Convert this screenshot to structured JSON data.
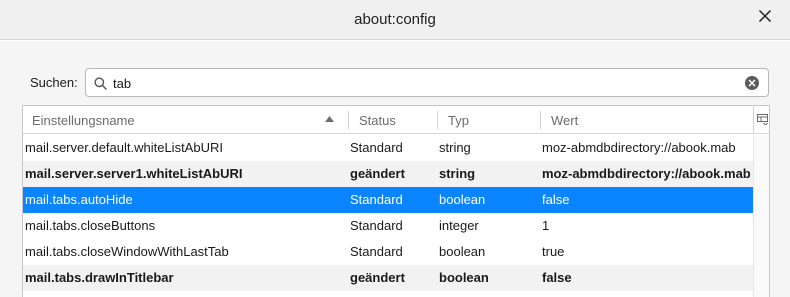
{
  "window": {
    "title": "about:config"
  },
  "search": {
    "label": "Suchen:",
    "value": "tab",
    "placeholder": ""
  },
  "table": {
    "columns": {
      "name": "Einstellungsname",
      "status": "Status",
      "type": "Typ",
      "value": "Wert"
    },
    "sort_column": "Einstellungsname",
    "sort_direction": "ascending",
    "rows": [
      {
        "name": "mail.server.default.whiteListAbURI",
        "status": "Standard",
        "type": "string",
        "value": "moz-abmdbdirectory://abook.mab"
      },
      {
        "name": "mail.server.server1.whiteListAbURI",
        "status": "geändert",
        "type": "string",
        "value": "moz-abmdbdirectory://abook.mab"
      },
      {
        "name": "mail.tabs.autoHide",
        "status": "Standard",
        "type": "boolean",
        "value": "false"
      },
      {
        "name": "mail.tabs.closeButtons",
        "status": "Standard",
        "type": "integer",
        "value": "1"
      },
      {
        "name": "mail.tabs.closeWindowWithLastTab",
        "status": "Standard",
        "type": "boolean",
        "value": "true"
      },
      {
        "name": "mail.tabs.drawInTitlebar",
        "status": "geändert",
        "type": "boolean",
        "value": "false"
      }
    ],
    "selected_row": 2
  },
  "colors": {
    "selection": "#0a84ff",
    "alt_row": "#f2f2f2",
    "titlebar": "#f0f0f0"
  }
}
